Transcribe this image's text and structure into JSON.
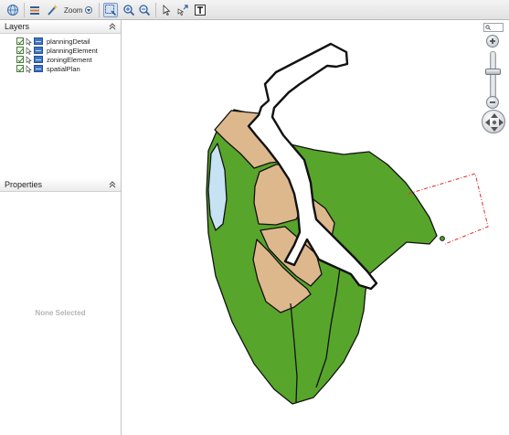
{
  "toolbar": {
    "zoom_label": "Zoom",
    "icons": [
      "globe-icon",
      "layers-toggle-icon",
      "wand-icon",
      "zoom-box-icon",
      "zoom-in-icon",
      "zoom-out-icon",
      "select-arrow-icon",
      "pan-select-icon",
      "text-tool-icon"
    ],
    "active_tool": "zoom-box-icon"
  },
  "layers_panel": {
    "title": "Layers",
    "layers": [
      {
        "label": "planningDetail",
        "checked": true
      },
      {
        "label": "planningElement",
        "checked": true
      },
      {
        "label": "zoningElement",
        "checked": true
      },
      {
        "label": "spatialPlan",
        "checked": true
      }
    ]
  },
  "properties_panel": {
    "title": "Properties",
    "empty_text": "None Selected"
  },
  "map": {
    "colors": {
      "green_zone": "#58a52b",
      "tan_zone": "#deb88d",
      "water": "#c7e2f3",
      "road": "#ffffff",
      "outline": "#111111",
      "selection_dashed": "#e23a3a"
    },
    "zoom_slider_level": 0.62
  }
}
